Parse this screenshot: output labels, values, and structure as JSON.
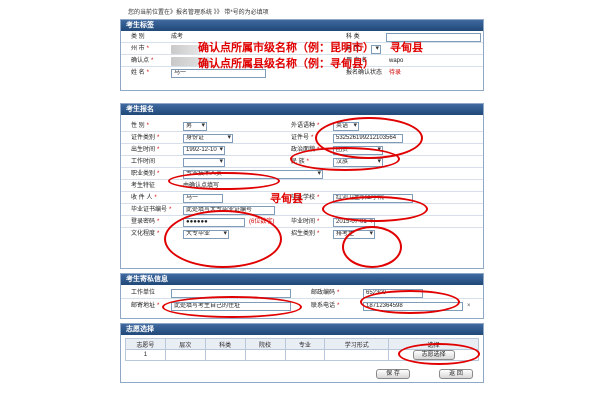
{
  "breadcrumb": {
    "prefix": "您的当前位置在》报名管理系统 》》",
    "suffix": "带*号的为必填项"
  },
  "candidate_tag": {
    "title": "考生标签",
    "category_label": "类 别",
    "category_value": "成考",
    "subject_label": "科 类",
    "city_label": "州 市",
    "district_label": "县 区",
    "district_value": "寻甸县",
    "confirm_point_label": "确认点",
    "username_label": "用 户 名",
    "username_value": "wapo",
    "name_label": "姓 名",
    "name_value": "马一",
    "status_label": "报名确认状态",
    "status_value": "待录"
  },
  "registration": {
    "title": "考生报名",
    "gender_label": "性 别",
    "gender_value": "男",
    "foreign_lang_label": "外语语种",
    "foreign_lang_value": "英语",
    "id_type_label": "证件类别",
    "id_type_value": "身份证",
    "id_no_label": "证件号",
    "id_no_value": "532526199212103564",
    "birth_label": "出生时间",
    "birth_value": "1992-12-10",
    "political_label": "政治面貌",
    "political_value": "团员",
    "work_time_label": "工作时间",
    "ethnic_label": "民 族",
    "ethnic_value": "汉族",
    "occupation_label": "职业类别",
    "occupation_value": "专业技术人员",
    "feature_label": "考生特征",
    "feature_value": "由确认点填写",
    "receiver_label": "收 件 人",
    "receiver_value": "马一",
    "grad_school_label": "毕业学校",
    "grad_school_value": "红河卫生职业学院",
    "cert_no_label": "毕业证书编号",
    "cert_no_value": "此处填写大专毕业证编号",
    "password_label": "登录密码",
    "password_value": "●●●●●●",
    "password_hint": "(6位数字)",
    "grad_time_label": "毕业时间",
    "grad_time_value": "2015-07-01",
    "education_label": "文化程度",
    "education_value": "大专毕业",
    "enroll_type_label": "招生类别",
    "enroll_type_value": "排考生"
  },
  "contact": {
    "title": "考生寄私信息",
    "work_unit_label": "工作单位",
    "postcode_label": "邮政编码",
    "postcode_value": "652300",
    "address_label": "邮寄地址",
    "address_value": "此处填写考生自己的住址",
    "phone_label": "联系电话",
    "phone_value": "18712364598"
  },
  "choices": {
    "title": "志愿选择",
    "columns": [
      "志愿号",
      "层次",
      "科类",
      "院校",
      "专业",
      "学习形式",
      "选择"
    ],
    "rows": [
      {
        "no": "1",
        "select_label": "志愿选择"
      }
    ],
    "save_label": "保 存",
    "back_label": "返 回"
  },
  "annotations": {
    "city_hint": "确认点所属市级名称（例：昆明市）",
    "point_hint": "确认点所属县级名称（例：寻甸县）",
    "district_hint": "寻甸县",
    "school_hint": "寻甸县"
  },
  "colors": {
    "header_bg": "#204878",
    "annotation_red": "#e00000",
    "required_red": "#d00000"
  }
}
